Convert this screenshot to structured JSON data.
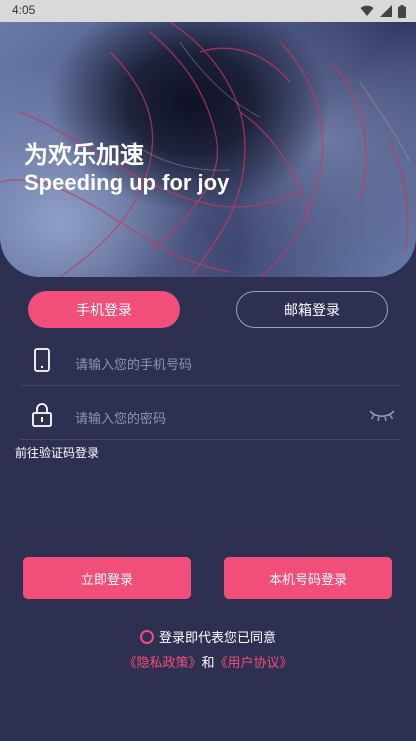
{
  "status_bar": {
    "time": "4:05"
  },
  "hero": {
    "title_cn": "为欢乐加速",
    "title_en": "Speeding up for joy"
  },
  "tabs": {
    "phone_label": "手机登录",
    "email_label": "邮箱登录"
  },
  "fields": {
    "phone_placeholder": "请输入您的手机号码",
    "password_placeholder": "请输入您的密码"
  },
  "code_login_link": "前往验证码登录",
  "buttons": {
    "login": "立即登录",
    "local_number_login": "本机号码登录"
  },
  "agreement": {
    "text": "登录即代表您已同意",
    "privacy": "《隐私政策》",
    "and": "和",
    "user_agreement": "《用户协议》"
  },
  "colors": {
    "accent": "#f24e7a",
    "background": "#2e3052"
  }
}
